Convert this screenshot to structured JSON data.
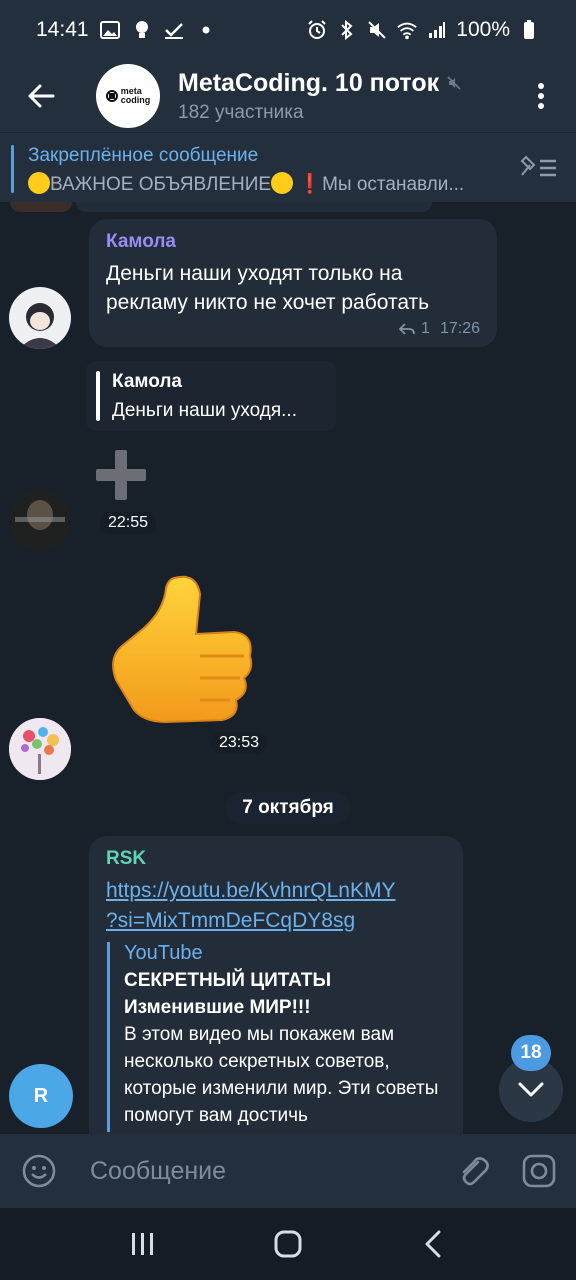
{
  "status_bar": {
    "time": "14:41",
    "battery": "100%",
    "icons_left": [
      "gallery-icon",
      "bulb-icon",
      "check-icon",
      "dot-icon"
    ],
    "icons_right": [
      "alarm-icon",
      "bluetooth-icon",
      "mute-icon",
      "wifi-icon",
      "signal-icon",
      "battery-icon"
    ]
  },
  "header": {
    "title": "MetaCoding. 10 поток",
    "subtitle": "182 участника",
    "avatar_logo_line1": "meta",
    "avatar_logo_line2": "coding"
  },
  "pinned": {
    "title": "Закреплённое сообщение",
    "text_a": "ВАЖНОЕ ОБЪЯВЛЕНИЕ",
    "text_b": "Мы останавли..."
  },
  "messages": {
    "m1": {
      "sender": "Камола",
      "sender_color": "#9b8cf5",
      "text": "Деньги наши уходят только на рекламу никто не хочет работать",
      "replies": "1",
      "time": "17:26"
    },
    "m2": {
      "quote_sender": "Камола",
      "quote_text": "Деньги наши уходя...",
      "time": "22:55"
    },
    "m3": {
      "time": "23:53"
    },
    "date_separator": "7 октября",
    "m4": {
      "sender": "RSK",
      "sender_color": "#5fd6b0",
      "avatar_letter": "R",
      "link": "https://youtu.be/KvhnrQLnKMY?si=MixTmmDeFCqDY8sg",
      "link_line1": "https://youtu.be/KvhnrQLnKMY",
      "link_line2": "?si=MixTmmDeFCqDY8sg",
      "preview_site": "YouTube",
      "preview_title": "СЕКРЕТНЫЙ ЦИТАТЫ Изменившие МИР!!!",
      "preview_description": "В этом видео мы покажем вам несколько секретных советов, которые изменили мир. Эти советы помогут вам достичь"
    }
  },
  "scroll_down": {
    "unread_count": "18"
  },
  "composer": {
    "placeholder": "Сообщение"
  },
  "colors": {
    "accent": "#4c9be2",
    "background": "#18202a",
    "panel": "#232f3c",
    "bubble": "#222d39"
  }
}
